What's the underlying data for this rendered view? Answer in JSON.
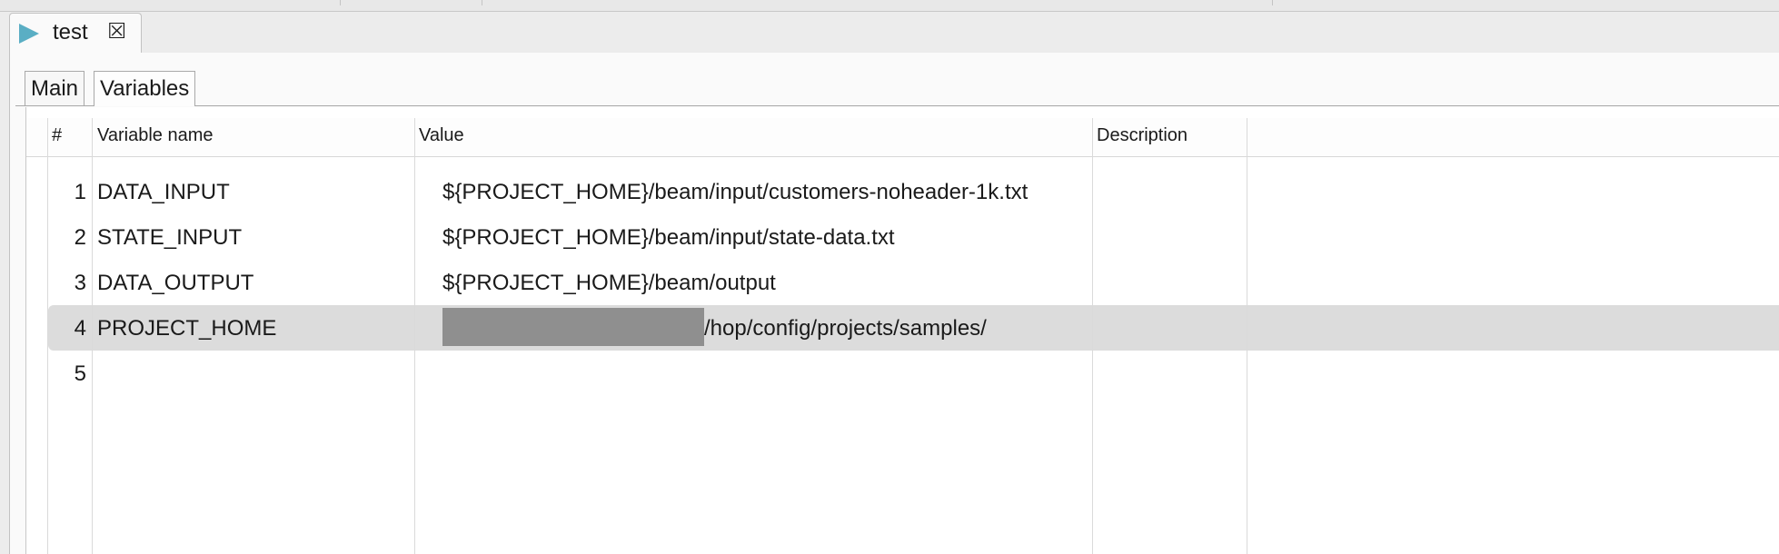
{
  "editor": {
    "tab_title": "test",
    "tab_icon": "pipeline-play-icon",
    "close_icon": "close-icon"
  },
  "subtabs": [
    {
      "label": "Main",
      "active": false
    },
    {
      "label": "Variables",
      "active": true
    }
  ],
  "table": {
    "columns": [
      "#",
      "Variable name",
      "Value",
      "Description"
    ],
    "rows": [
      {
        "num": "1",
        "name": "DATA_INPUT",
        "value": "${PROJECT_HOME}/beam/input/customers-noheader-1k.txt",
        "description": ""
      },
      {
        "num": "2",
        "name": "STATE_INPUT",
        "value": "${PROJECT_HOME}/beam/input/state-data.txt",
        "description": ""
      },
      {
        "num": "3",
        "name": "DATA_OUTPUT",
        "value": "${PROJECT_HOME}/beam/output",
        "description": ""
      },
      {
        "num": "4",
        "name": "PROJECT_HOME",
        "value_visible_suffix": "/hop/config/projects/samples/",
        "value_prefix_redacted": true,
        "description": "",
        "selected": true
      },
      {
        "num": "5",
        "name": "",
        "value": "",
        "description": ""
      }
    ]
  },
  "colors": {
    "selected_row": "#dcdcdc",
    "play_icon": "#5aaec4",
    "redaction": "#8f8f8f"
  }
}
